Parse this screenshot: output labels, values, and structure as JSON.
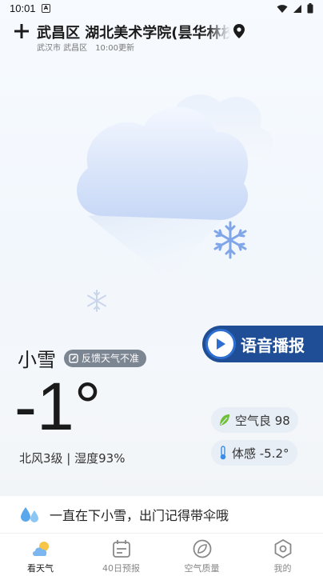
{
  "status_bar": {
    "time": "10:01",
    "app_badge": "A"
  },
  "header": {
    "location": "武昌区 湖北美术学院(昙华林校",
    "city_district": "武汉市 武昌区",
    "updated": "10:00更新"
  },
  "weather": {
    "condition": "小雪",
    "feedback_label": "反馈天气不准",
    "temperature": "-1°",
    "wind_humidity": "北风3级 | 湿度93%",
    "voice_label": "语音播报",
    "aqi_label": "空气良 98",
    "feels_like": "体感 -5.2°"
  },
  "tip": {
    "text": "一直在下小雪，出门记得带伞哦"
  },
  "bottom_nav": [
    {
      "label": "看天气",
      "icon": "weather-icon",
      "active": true
    },
    {
      "label": "40日预报",
      "icon": "calendar-icon",
      "active": false
    },
    {
      "label": "空气质量",
      "icon": "leaf-icon",
      "active": false
    },
    {
      "label": "我的",
      "icon": "profile-icon",
      "active": false
    }
  ],
  "colors": {
    "accent": "#1f4e96",
    "pill_bg": "#e8eef6",
    "feedback_bg": "#7c8592"
  }
}
